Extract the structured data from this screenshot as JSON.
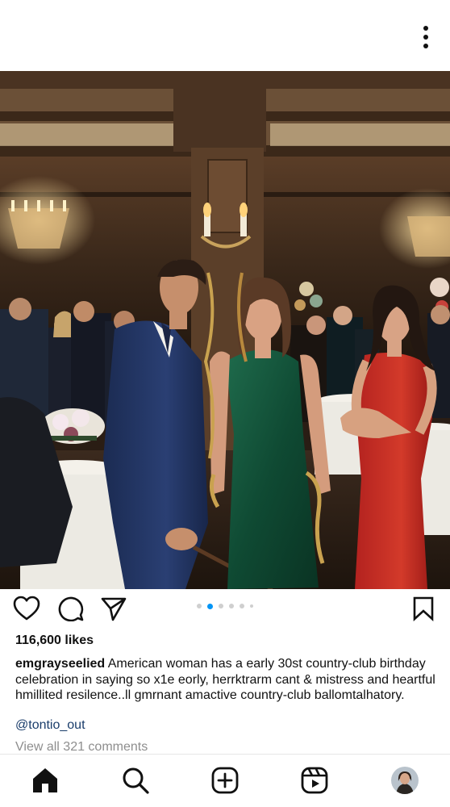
{
  "post": {
    "more_icon": "more-vertical-icon",
    "image_alt": "Party scene in a country-club ballroom",
    "carousel": {
      "count": 5,
      "active_index": 1
    },
    "likes": "116,600 likes",
    "caption_user": "emgrayseelied",
    "caption_text": " American woman has a early 30st country-club birthday celebration in saying so x1e eorly, herrktrarm cant & mistress and heartful hmillited resilence..ll gmrnant amactive country-club ballomtalhatory.",
    "mention": "@tontio_out",
    "view_comments": "View all 321 comments"
  },
  "actions": {
    "like_icon": "heart-icon",
    "comment_icon": "comment-icon",
    "share_icon": "send-icon",
    "save_icon": "bookmark-icon"
  },
  "nav": {
    "items": [
      "home-icon",
      "search-icon",
      "create-icon",
      "reels-icon",
      "profile-avatar"
    ]
  },
  "colors": {
    "accent": "#0095f6",
    "mention": "#1a3d6b",
    "muted": "#8e8e8e"
  }
}
